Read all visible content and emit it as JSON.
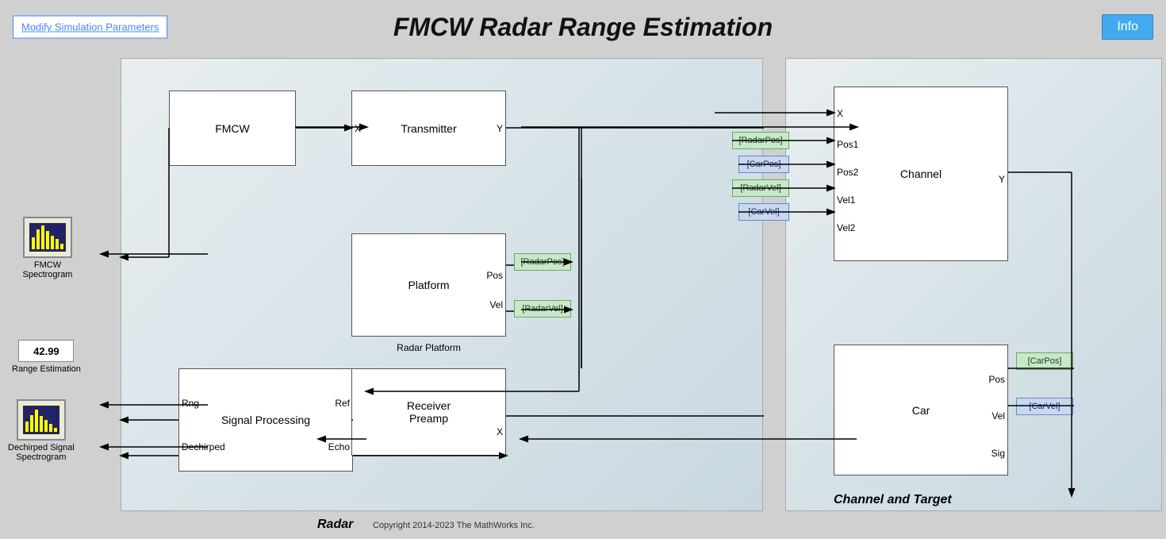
{
  "header": {
    "title": "FMCW Radar Range Estimation",
    "modify_button_label": "Modify Simulation Parameters",
    "info_button_label": "Info"
  },
  "diagram": {
    "radar_label": "Radar",
    "copyright": "Copyright 2014-2023 The MathWorks Inc.",
    "channel_and_target_label": "Channel and Target",
    "blocks": {
      "fmcw": "FMCW",
      "transmitter": "Transmitter",
      "platform": "Platform",
      "signal_processing_line1": "Signal Processing",
      "receiver_preamp_line1": "Receiver",
      "receiver_preamp_line2": "Preamp",
      "channel": "Channel",
      "car": "Car",
      "radar_platform_label": "Radar Platform"
    },
    "ports": {
      "tx_x": "X",
      "tx_y": "Y",
      "transmitter_x": "X",
      "transmitter_y": "Y",
      "channel_x": "X",
      "channel_pos1": "Pos1",
      "channel_pos2": "Pos2",
      "channel_vel1": "Vel1",
      "channel_vel2": "Vel2",
      "channel_y": "Y",
      "platform_pos": "Pos",
      "platform_vel": "Vel",
      "sigproc_rng": "Rng",
      "sigproc_ref": "Ref",
      "sigproc_echo": "Echo",
      "sigproc_dechirped": "Dechirped",
      "receiver_x": "X",
      "car_pos": "Pos",
      "car_vel": "Vel",
      "car_sig": "Sig"
    },
    "goto_tags": {
      "radar_pos": "[RadarPos]",
      "car_pos": "[CarPos]",
      "radar_vel": "[RadarVel]",
      "car_vel": "[CarVel]",
      "from_radar_pos": "[RadarPos]",
      "from_car_pos": "[CarPos]",
      "from_radar_vel": "[RadarVel]",
      "from_car_vel": "[CarVel]"
    },
    "scope_blocks": {
      "fmcw_spectrogram": "FMCW Spectrogram",
      "range_estimation": "Range Estimation",
      "dechirped_signal": "Dechirped Signal\nSpectrogram",
      "range_value": "42.99"
    }
  }
}
